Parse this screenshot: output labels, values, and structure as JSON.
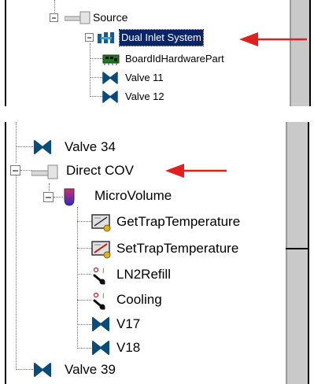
{
  "top_tree": {
    "source_label": "Source",
    "dual_inlet_label": "Dual Inlet System",
    "board_label": "BoardIdHardwarePart",
    "valve11_label": "Valve 11",
    "valve12_label": "Valve 12"
  },
  "bottom_tree": {
    "valve34_label": "Valve 34",
    "direct_cov_label": "Direct COV",
    "microvolume_label": "MicroVolume",
    "get_trap_label": "GetTrapTemperature",
    "set_trap_label": "SetTrapTemperature",
    "ln2_label": "LN2Refill",
    "cooling_label": "Cooling",
    "v17_label": "V17",
    "v18_label": "V18",
    "valve39_label": "Valve 39"
  },
  "colors": {
    "arrow": "#e02020",
    "valve_icon": "#0b4b7a",
    "selection": "#0a246a"
  }
}
